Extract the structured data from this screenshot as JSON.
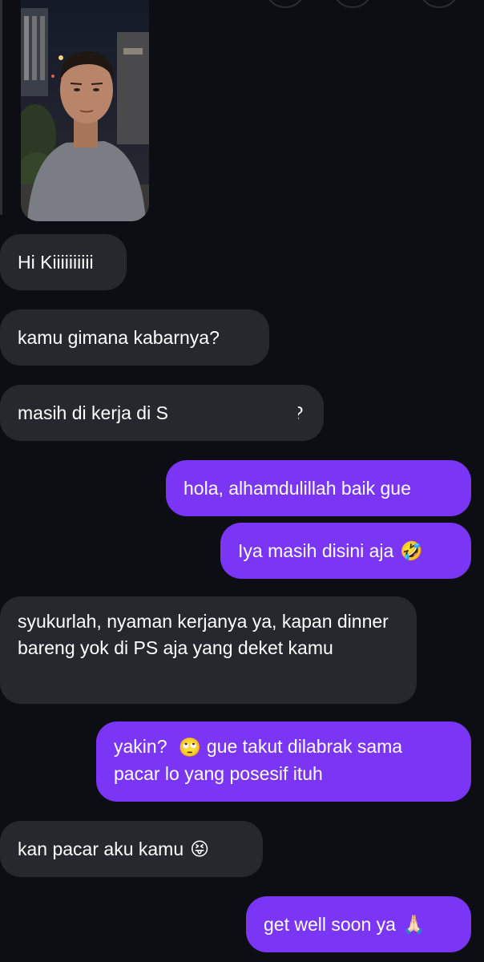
{
  "colors": {
    "background": "#0c0e13",
    "incoming_bubble": "#26282d",
    "outgoing_bubble": "#7a35f5",
    "text": "#ffffff"
  },
  "messages": [
    {
      "direction": "incoming",
      "text": "Hi Kiiiiiiiiii"
    },
    {
      "direction": "incoming",
      "text": "kamu gimana kabarnya?"
    },
    {
      "direction": "incoming",
      "text": "masih di kerja di S",
      "text_end": "s?"
    },
    {
      "direction": "outgoing",
      "text": "hola, alhamdulillah baik gue"
    },
    {
      "direction": "outgoing",
      "text": "Iya masih disini aja",
      "emoji": "🤣"
    },
    {
      "direction": "incoming",
      "text": "syukurlah, nyaman kerjanya ya, kapan dinner bareng yok di PS aja yang deket kamu"
    },
    {
      "direction": "outgoing",
      "text": "yakin?",
      "emoji": "🙄",
      "text_end": "gue takut dilabrak sama pacar lo yang posesif ituh"
    },
    {
      "direction": "incoming",
      "text": "kan pacar aku kamu",
      "emoji": "😝"
    },
    {
      "direction": "outgoing",
      "text": "get well soon ya",
      "emoji": "🙏🏻"
    }
  ]
}
